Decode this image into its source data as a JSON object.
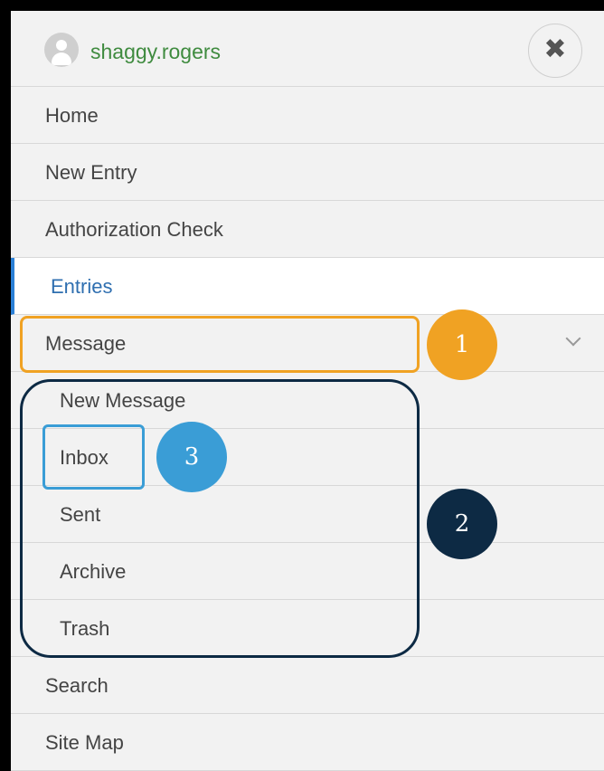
{
  "user": {
    "username": "shaggy.rogers",
    "avatar_icon": "user-avatar-icon",
    "close_icon": "close-icon",
    "close_glyph": "✖"
  },
  "nav": {
    "items": [
      {
        "label": "Home"
      },
      {
        "label": "New Entry"
      },
      {
        "label": "Authorization Check"
      },
      {
        "label": "Entries",
        "active": true
      },
      {
        "label": "Message",
        "expanded": true,
        "icon": "chevron-down-icon"
      },
      {
        "label": "New Message",
        "submenu_of": "Message"
      },
      {
        "label": "Inbox",
        "submenu_of": "Message"
      },
      {
        "label": "Sent",
        "submenu_of": "Message"
      },
      {
        "label": "Archive",
        "submenu_of": "Message"
      },
      {
        "label": "Trash",
        "submenu_of": "Message"
      },
      {
        "label": "Search"
      },
      {
        "label": "Site Map"
      }
    ]
  },
  "annotations": [
    {
      "number": "1",
      "color": "#f0a223"
    },
    {
      "number": "2",
      "color": "#0d2a44"
    },
    {
      "number": "3",
      "color": "#3a9dd6"
    }
  ],
  "colors": {
    "username": "#3f8b3f",
    "active_text": "#2f6fb0",
    "active_bar": "#2a7fd6",
    "background": "#f2f2f2"
  }
}
